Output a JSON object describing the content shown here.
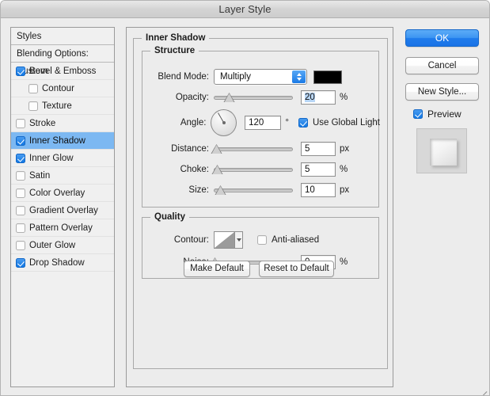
{
  "window": {
    "title": "Layer Style"
  },
  "styles_panel": {
    "header": "Styles",
    "blending_options": "Blending Options: Custom",
    "items": [
      {
        "label": "Bevel & Emboss",
        "checked": true,
        "sub": false,
        "selected": false
      },
      {
        "label": "Contour",
        "checked": false,
        "sub": true,
        "selected": false
      },
      {
        "label": "Texture",
        "checked": false,
        "sub": true,
        "selected": false
      },
      {
        "label": "Stroke",
        "checked": false,
        "sub": false,
        "selected": false
      },
      {
        "label": "Inner Shadow",
        "checked": true,
        "sub": false,
        "selected": true
      },
      {
        "label": "Inner Glow",
        "checked": true,
        "sub": false,
        "selected": false
      },
      {
        "label": "Satin",
        "checked": false,
        "sub": false,
        "selected": false
      },
      {
        "label": "Color Overlay",
        "checked": false,
        "sub": false,
        "selected": false
      },
      {
        "label": "Gradient Overlay",
        "checked": false,
        "sub": false,
        "selected": false
      },
      {
        "label": "Pattern Overlay",
        "checked": false,
        "sub": false,
        "selected": false
      },
      {
        "label": "Outer Glow",
        "checked": false,
        "sub": false,
        "selected": false
      },
      {
        "label": "Drop Shadow",
        "checked": true,
        "sub": false,
        "selected": false
      }
    ]
  },
  "main": {
    "group_title": "Inner Shadow",
    "structure": {
      "title": "Structure",
      "blend_mode_label": "Blend Mode:",
      "blend_mode_value": "Multiply",
      "blend_color": "#000000",
      "opacity_label": "Opacity:",
      "opacity_value": "20",
      "opacity_unit": "%",
      "opacity_percent": 20,
      "angle_label": "Angle:",
      "angle_value": "120",
      "angle_unit": "°",
      "use_global_light_label": "Use Global Light",
      "use_global_light_checked": true,
      "distance_label": "Distance:",
      "distance_value": "5",
      "distance_unit": "px",
      "distance_percent": 4,
      "choke_label": "Choke:",
      "choke_value": "5",
      "choke_unit": "%",
      "choke_percent": 5,
      "size_label": "Size:",
      "size_value": "10",
      "size_unit": "px",
      "size_percent": 9
    },
    "quality": {
      "title": "Quality",
      "contour_label": "Contour:",
      "anti_aliased_label": "Anti-aliased",
      "anti_aliased_checked": false,
      "noise_label": "Noise:",
      "noise_value": "0",
      "noise_unit": "%",
      "noise_percent": 2
    },
    "make_default": "Make Default",
    "reset_to_default": "Reset to Default"
  },
  "buttons": {
    "ok": "OK",
    "cancel": "Cancel",
    "new_style": "New Style...",
    "preview_label": "Preview",
    "preview_checked": true
  },
  "colors": {
    "accent": "#1a73e6",
    "selection": "#7cb8f2",
    "window_bg": "#ececec"
  }
}
